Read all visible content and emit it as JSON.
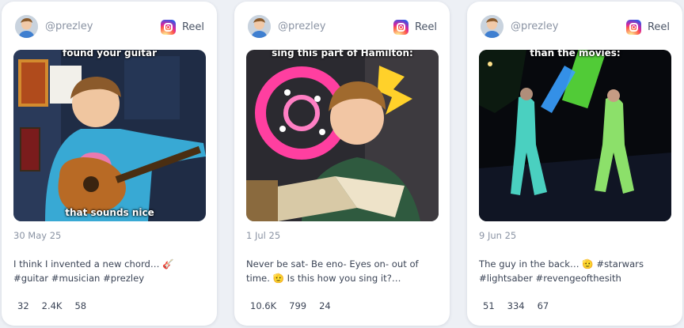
{
  "posts": [
    {
      "handle": "@prezley",
      "platform_label": "Reel",
      "overlay_top": "found your guitar",
      "overlay_bottom": "that sounds nice",
      "date": "30 May 25",
      "caption": "I think I invented a new chord… 🎸\n#guitar #musician #prezley",
      "stats": [
        "32",
        "2.4K",
        "58"
      ]
    },
    {
      "handle": "@prezley",
      "platform_label": "Reel",
      "overlay_top": "sing this part of Hamilton:",
      "overlay_bottom": "",
      "date": "1 Jul 25",
      "caption": "Never be sat- Be eno- Eyes on- out of\ntime. 🫡 Is this how you sing it?…",
      "stats": [
        "10.6K",
        "799",
        "24"
      ]
    },
    {
      "handle": "@prezley",
      "platform_label": "Reel",
      "overlay_top": "than the movies:",
      "overlay_bottom": "",
      "date": "9 Jun 25",
      "caption": "The guy in the back… 🫡 #starwars\n#lightsaber #revengeofthesith",
      "stats": [
        "51",
        "334",
        "67"
      ]
    }
  ],
  "colors": {
    "background": "#edf0f5",
    "card": "#ffffff",
    "muted_text": "#8a93a3",
    "body_text": "#3b4456"
  },
  "icons": {
    "platform": "instagram-icon",
    "avatar": "user-avatar"
  }
}
